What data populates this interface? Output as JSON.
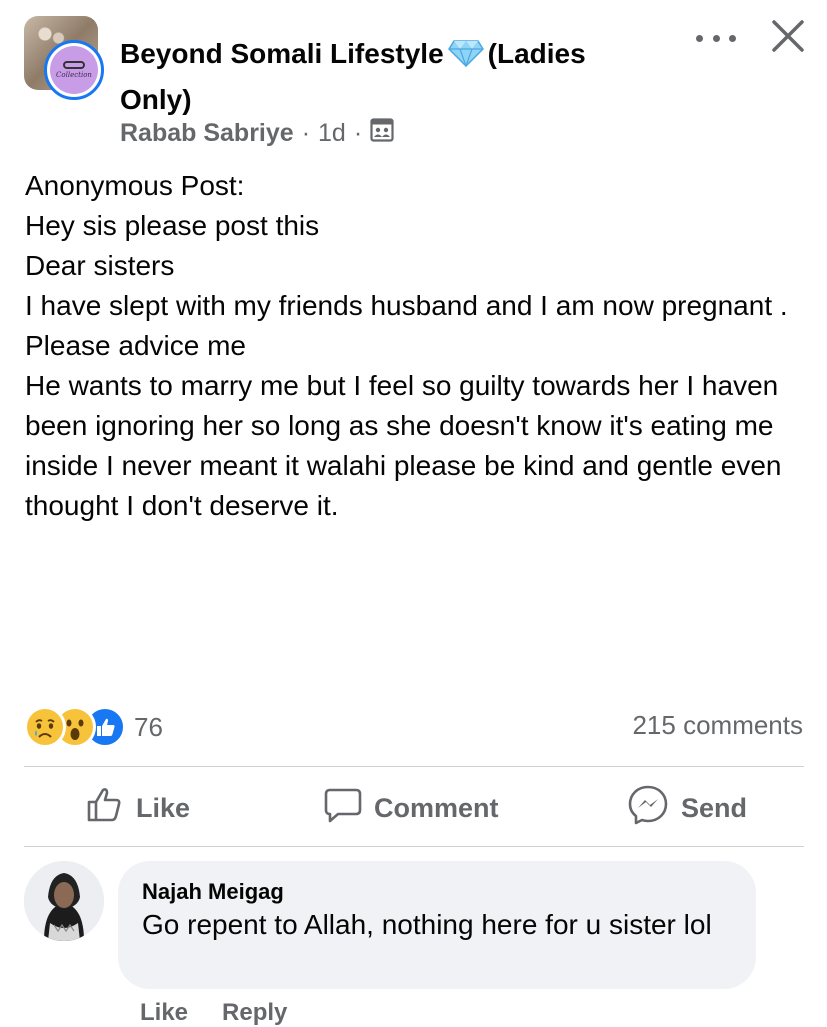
{
  "post": {
    "group_name": "Beyond Somali Lifestyle",
    "group_name_suffix": "(Ladies Only)",
    "author": "Rabab Sabriye",
    "time": "1d",
    "avatar_text": "Collection",
    "paragraphs": [
      "Anonymous Post:",
      "",
      "",
      "Hey sis please post this",
      "",
      "Dear sisters",
      "",
      "I have slept with my friends husband and I am now pregnant . Please advice me",
      "He wants to marry me but I feel so guilty towards her I haven been ignoring her so long as she doesn't know it's eating me inside I never meant it walahi please be kind and gentle even thought I don't deserve it."
    ]
  },
  "reactions": {
    "icons": [
      "sad-reaction",
      "wow-reaction",
      "like-reaction"
    ],
    "count": "76"
  },
  "comments_count": "215 comments",
  "actions": {
    "like": "Like",
    "comment": "Comment",
    "send": "Send"
  },
  "comment": {
    "author": "Najah Meigag",
    "text": "Go repent to Allah, nothing here for u sister lol",
    "like_label": "Like",
    "reply_label": "Reply"
  },
  "colors": {
    "accent": "#1877f2",
    "secondary_text": "#65676b",
    "bubble": "#f0f2f5"
  }
}
